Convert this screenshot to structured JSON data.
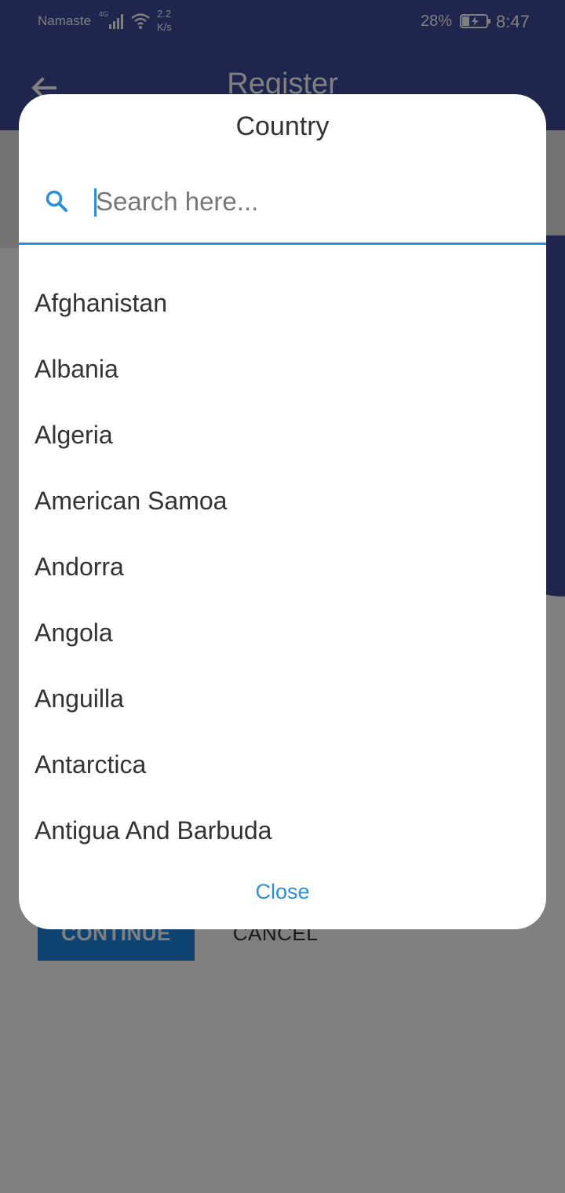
{
  "status_bar": {
    "carrier": "Namaste",
    "network_type": "4G",
    "speed_value": "2.2",
    "speed_unit": "K/s",
    "battery_percent": "28%",
    "time": "8:47"
  },
  "app_bar": {
    "title": "Register",
    "back_icon": "arrow-left-icon"
  },
  "background_actions": {
    "continue_label": "CONTINUE",
    "cancel_label": "CANCEL"
  },
  "dialog": {
    "title": "Country",
    "search": {
      "icon": "search-icon",
      "placeholder": "Search here...",
      "value": ""
    },
    "countries": [
      "Afghanistan",
      "Albania",
      "Algeria",
      "American Samoa",
      "Andorra",
      "Angola",
      "Anguilla",
      "Antarctica",
      "Antigua And Barbuda"
    ],
    "close_label": "Close"
  },
  "colors": {
    "primary": "#3f4a99",
    "accent": "#2d8fd5",
    "button": "#1e88e5"
  }
}
